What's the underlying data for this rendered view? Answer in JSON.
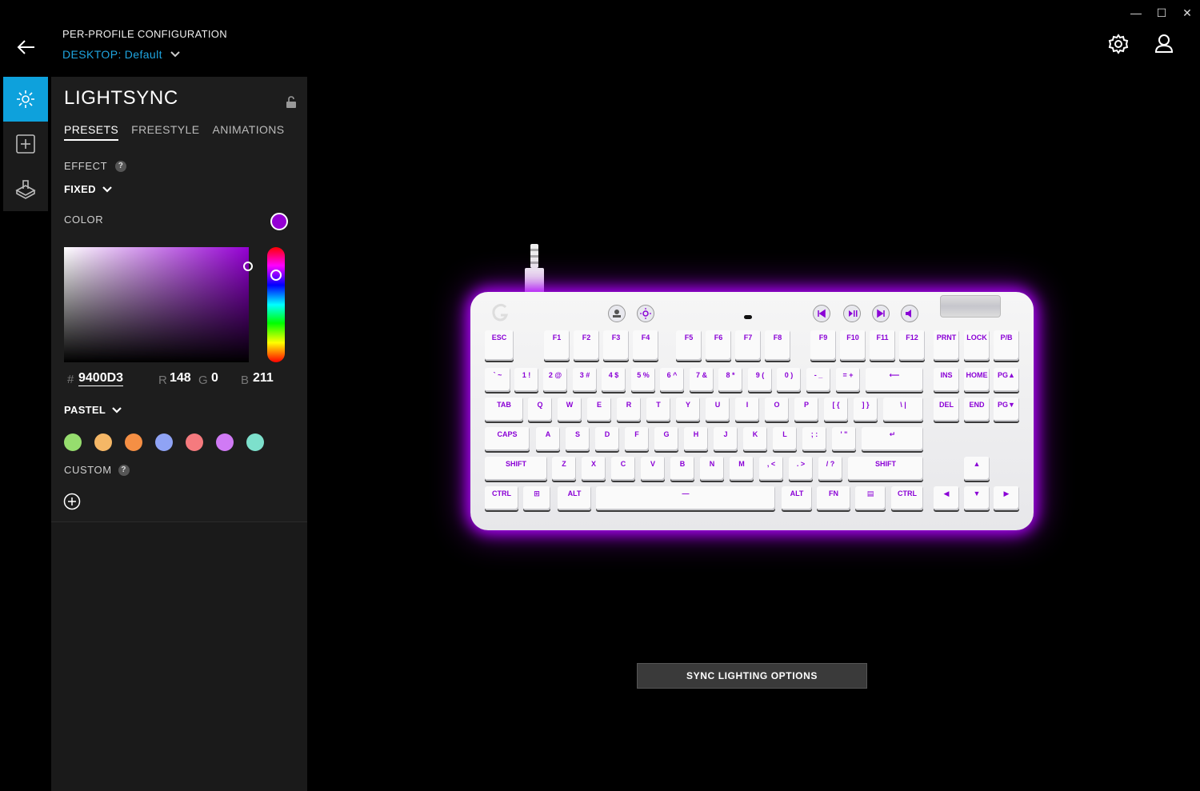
{
  "window": {
    "minimize": "—",
    "maximize": "☐",
    "close": "✕"
  },
  "header": {
    "title": "PER-PROFILE CONFIGURATION",
    "profile_prefix": "DESKTOP:",
    "profile_name": "Default"
  },
  "nav": {
    "items": [
      {
        "name": "lightsync",
        "icon": "sun-icon",
        "active": true
      },
      {
        "name": "assignments",
        "icon": "plus-box-icon",
        "active": false
      },
      {
        "name": "game-mode",
        "icon": "keyboard-key-icon",
        "active": false
      }
    ]
  },
  "panel": {
    "title": "LIGHTSYNC",
    "tabs": [
      "PRESETS",
      "FREESTYLE",
      "ANIMATIONS"
    ],
    "effect_label": "EFFECT",
    "effect_value": "FIXED",
    "color_label": "COLOR",
    "hex": "9400D3",
    "hash": "#",
    "r_label": "R",
    "r": "148",
    "g_label": "G",
    "g": "0",
    "b_label": "B",
    "b": "211",
    "palette_label": "PASTEL",
    "swatches": [
      "#96dd6e",
      "#f5b766",
      "#f58f44",
      "#8fa3f5",
      "#f57a7e",
      "#d07af5",
      "#7de0cc"
    ],
    "custom_label": "CUSTOM",
    "selected_color": "#9400D3"
  },
  "keyboard": {
    "rows": [
      [
        "ESC",
        "F1",
        "F2",
        "F3",
        "F4",
        "F5",
        "F6",
        "F7",
        "F8",
        "F9",
        "F10",
        "F11",
        "F12",
        "PRNT",
        "LOCK",
        "P/B"
      ],
      [
        "` ~",
        "1 !",
        "2 @",
        "3 #",
        "4 $",
        "5 %",
        "6 ^",
        "7 &",
        "8 *",
        "9 (",
        "0 )",
        "- _",
        "= +",
        "⟵",
        "INS",
        "HOME",
        "PG▲"
      ],
      [
        "TAB",
        "Q",
        "W",
        "E",
        "R",
        "T",
        "Y",
        "U",
        "I",
        "O",
        "P",
        "[ {",
        "] }",
        "\\ |",
        "DEL",
        "END",
        "PG▼"
      ],
      [
        "CAPS",
        "A",
        "S",
        "D",
        "F",
        "G",
        "H",
        "J",
        "K",
        "L",
        "; :",
        "' \"",
        "↵"
      ],
      [
        "SHIFT",
        "Z",
        "X",
        "C",
        "V",
        "B",
        "N",
        "M",
        ", <",
        ". >",
        "/ ?",
        "SHIFT",
        "▲"
      ],
      [
        "CTRL",
        "⊞",
        "ALT",
        "—",
        "ALT",
        "FN",
        "▤",
        "CTRL",
        "◀",
        "▼",
        "▶"
      ]
    ]
  },
  "sync_button": "SYNC LIGHTING OPTIONS"
}
